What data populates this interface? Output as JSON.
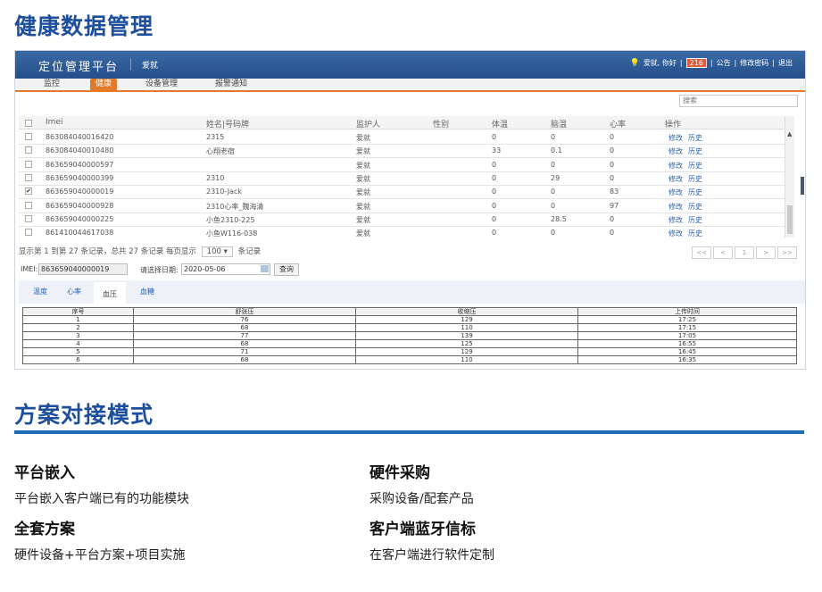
{
  "headings": {
    "top": "健康数据管理",
    "bottom": "方案对接模式"
  },
  "app": {
    "brand": "定位管理平台",
    "brand_user": "爱就",
    "greeting": "爱就, 你好",
    "sep": "|",
    "count": "216",
    "links": [
      "公告",
      "修改密码",
      "退出"
    ]
  },
  "nav": [
    {
      "label": "监控",
      "active": false
    },
    {
      "label": "健康",
      "active": true
    },
    {
      "label": "设备管理",
      "active": false
    },
    {
      "label": "报警通知",
      "active": false
    }
  ],
  "search_placeholder": "搜索",
  "grid": {
    "columns": [
      "Imei",
      "姓名|号码牌",
      "监护人",
      "性别",
      "体温",
      "脑温",
      "心率",
      "操作"
    ],
    "rows": [
      {
        "checked": false,
        "imei": "863084040016420",
        "name": "2315",
        "guardian": "爱就",
        "gender": "",
        "temp": "0",
        "brain": "0",
        "hr": "0"
      },
      {
        "checked": false,
        "imei": "863084040010480",
        "name": "心翔老宿",
        "guardian": "爱就",
        "gender": "",
        "temp": "33",
        "brain": "0.1",
        "hr": "0"
      },
      {
        "checked": false,
        "imei": "863659040000597",
        "name": "",
        "guardian": "爱就",
        "gender": "",
        "temp": "0",
        "brain": "0",
        "hr": "0"
      },
      {
        "checked": false,
        "imei": "863659040000399",
        "name": "2310",
        "guardian": "爱就",
        "gender": "",
        "temp": "0",
        "brain": "29",
        "hr": "0"
      },
      {
        "checked": true,
        "imei": "863659040000019",
        "name": "2310-Jack",
        "guardian": "爱就",
        "gender": "",
        "temp": "0",
        "brain": "0",
        "hr": "83"
      },
      {
        "checked": false,
        "imei": "863659040000928",
        "name": "2310心率_魏海清",
        "guardian": "爱就",
        "gender": "",
        "temp": "0",
        "brain": "0",
        "hr": "97"
      },
      {
        "checked": false,
        "imei": "863659040000225",
        "name": "小鱼2310-225",
        "guardian": "爱就",
        "gender": "",
        "temp": "0",
        "brain": "28.5",
        "hr": "0"
      },
      {
        "checked": false,
        "imei": "861410044617038",
        "name": "小鱼W116-038",
        "guardian": "爱就",
        "gender": "",
        "temp": "0",
        "brain": "0",
        "hr": "0"
      }
    ],
    "action_edit": "修改",
    "action_history": "历史"
  },
  "pager": {
    "summary": "显示第 1 到第 27 条记录，总共 27 条记录 每页显示",
    "page_size": "100 ▾",
    "suffix": "条记录",
    "buttons": [
      "<<",
      "<",
      "1",
      ">",
      ">>"
    ]
  },
  "query": {
    "imei_label": "IMEI:",
    "imei_value": "863659040000019",
    "date_label": "请选择日期:",
    "date_value": "2020-05-06",
    "button": "查询"
  },
  "tabs": [
    {
      "label": "温度",
      "active": false
    },
    {
      "label": "心率",
      "active": false
    },
    {
      "label": "血压",
      "active": true
    },
    {
      "label": "血糖",
      "active": false
    }
  ],
  "bp_table": {
    "headers": [
      "序号",
      "舒张压",
      "收缩压",
      "上传时间"
    ],
    "rows": [
      [
        "1",
        "76",
        "129",
        "17:25"
      ],
      [
        "2",
        "68",
        "110",
        "17:15"
      ],
      [
        "3",
        "77",
        "139",
        "17:05"
      ],
      [
        "4",
        "68",
        "125",
        "16:55"
      ],
      [
        "5",
        "71",
        "129",
        "16:45"
      ],
      [
        "6",
        "68",
        "110",
        "16:35"
      ]
    ]
  },
  "modes": [
    {
      "title": "平台嵌入",
      "desc": "平台嵌入客户端已有的功能模块"
    },
    {
      "title": "硬件采购",
      "desc": "采购设备/配套产品"
    },
    {
      "title": "全套方案",
      "desc": "硬件设备+平台方案+项目实施"
    },
    {
      "title": "客户端蓝牙信标",
      "desc": "在客户端进行软件定制"
    }
  ]
}
